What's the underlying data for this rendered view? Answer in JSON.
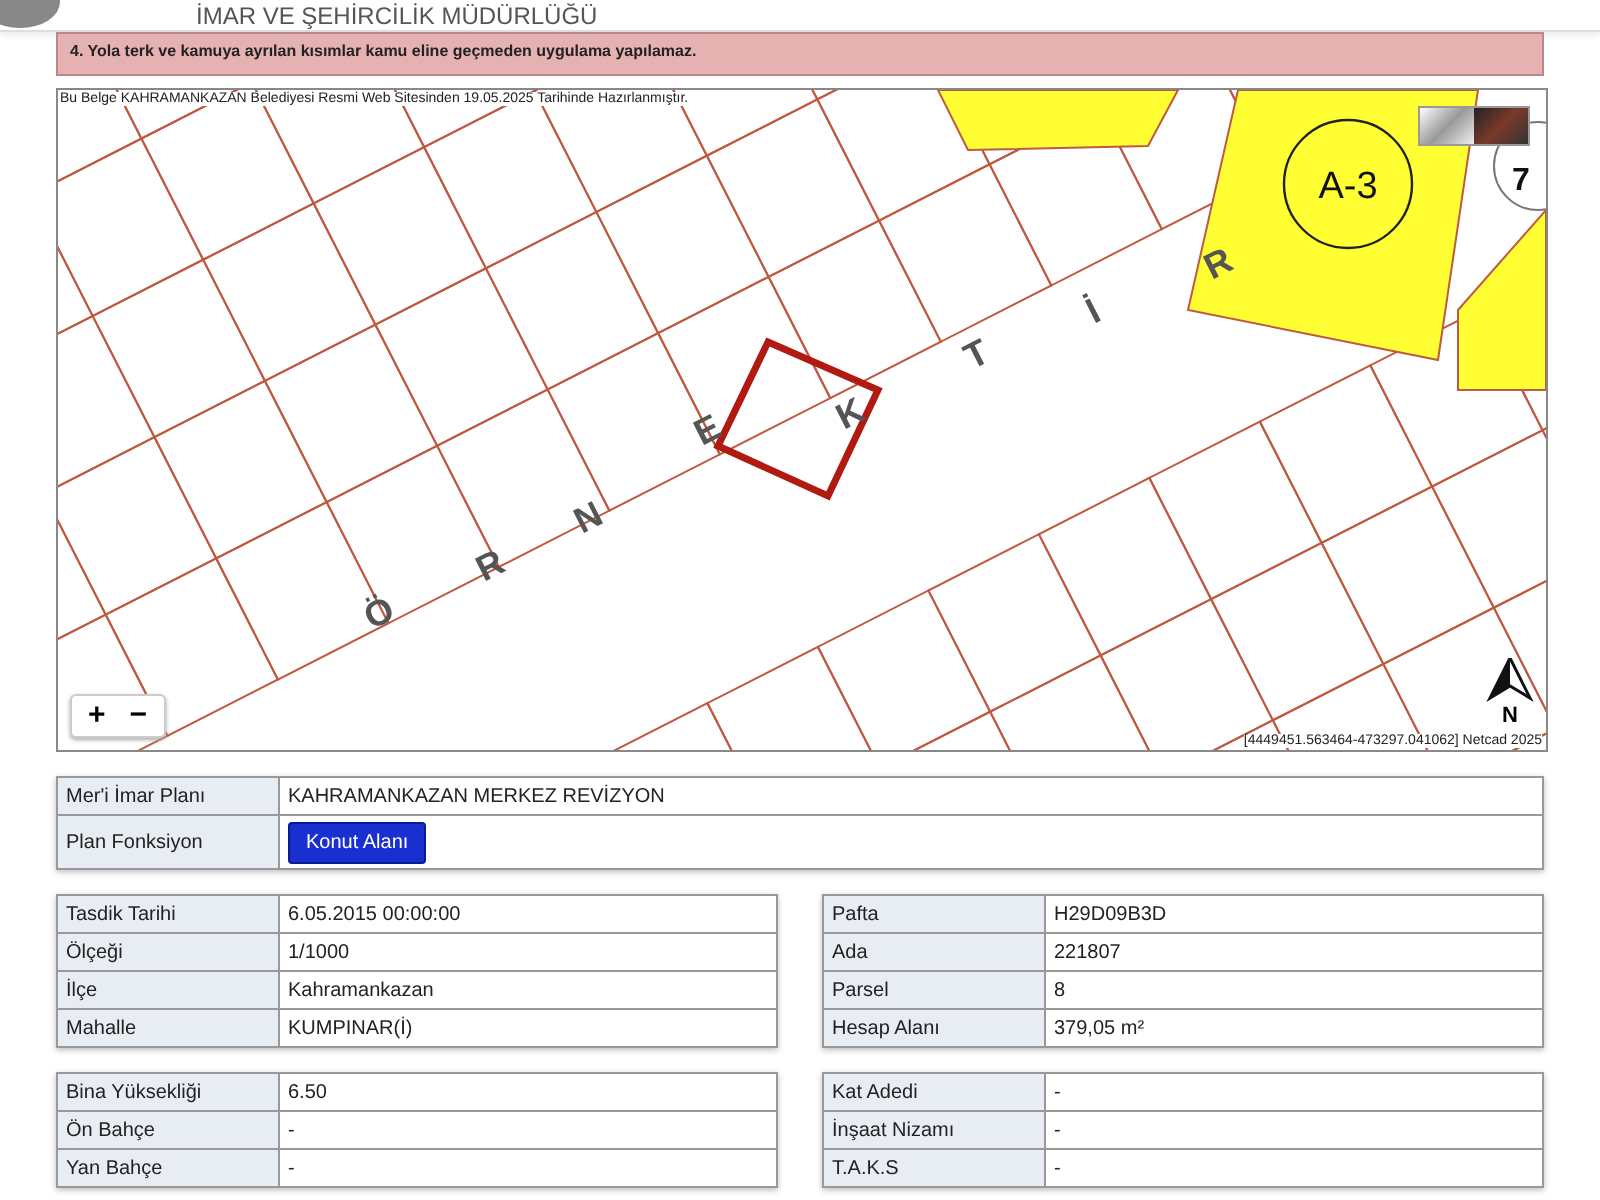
{
  "header": {
    "title": "İMAR VE ŞEHİRCİLİK MÜDÜRLÜĞÜ"
  },
  "notice": {
    "text": "4. Yola terk ve kamuya ayrılan kısımlar kamu eline geçmeden uygulama yapılamaz."
  },
  "map": {
    "caption": "Bu Belge KAHRAMANKAZAN Belediyesi Resmi Web Sitesinden 19.05.2025 Tarihinde Hazırlanmıştır.",
    "labels": [
      {
        "kind": "zone",
        "text": "A-3"
      },
      {
        "kind": "block",
        "text": "7"
      }
    ],
    "street_letters": [
      "Ö",
      "R",
      "N",
      "E",
      "K",
      "T",
      "İ",
      "R"
    ],
    "zoom_in": "+",
    "zoom_out": "−",
    "north": "N",
    "attribution": "[4449451.563464-473297.041062] Netcad 2025"
  },
  "plan": {
    "rows": [
      {
        "label": "Mer'i İmar Planı",
        "value": "KAHRAMANKAZAN MERKEZ REVİZYON",
        "kind": "text"
      },
      {
        "label": "Plan Fonksiyon",
        "value": "Konut Alanı",
        "kind": "tag"
      }
    ]
  },
  "tables": [
    {
      "rows": [
        {
          "label": "Tasdik Tarihi",
          "value": "6.05.2015 00:00:00"
        },
        {
          "label": "Ölçeği",
          "value": "1/1000"
        },
        {
          "label": "İlçe",
          "value": "Kahramankazan"
        },
        {
          "label": "Mahalle",
          "value": "KUMPINAR(İ)"
        }
      ]
    },
    {
      "rows": [
        {
          "label": "Pafta",
          "value": "H29D09B3D"
        },
        {
          "label": "Ada",
          "value": "221807"
        },
        {
          "label": "Parsel",
          "value": "8"
        },
        {
          "label": "Hesap Alanı",
          "value": "379,05 m²"
        }
      ]
    },
    {
      "rows": [
        {
          "label": "Bina Yüksekliği",
          "value": "6.50"
        },
        {
          "label": "Ön Bahçe",
          "value": "-"
        },
        {
          "label": "Yan Bahçe",
          "value": "-"
        }
      ]
    },
    {
      "rows": [
        {
          "label": "Kat Adedi",
          "value": "-"
        },
        {
          "label": "İnşaat Nizamı",
          "value": "-"
        },
        {
          "label": "T.A.K.S",
          "value": "-"
        }
      ]
    }
  ]
}
